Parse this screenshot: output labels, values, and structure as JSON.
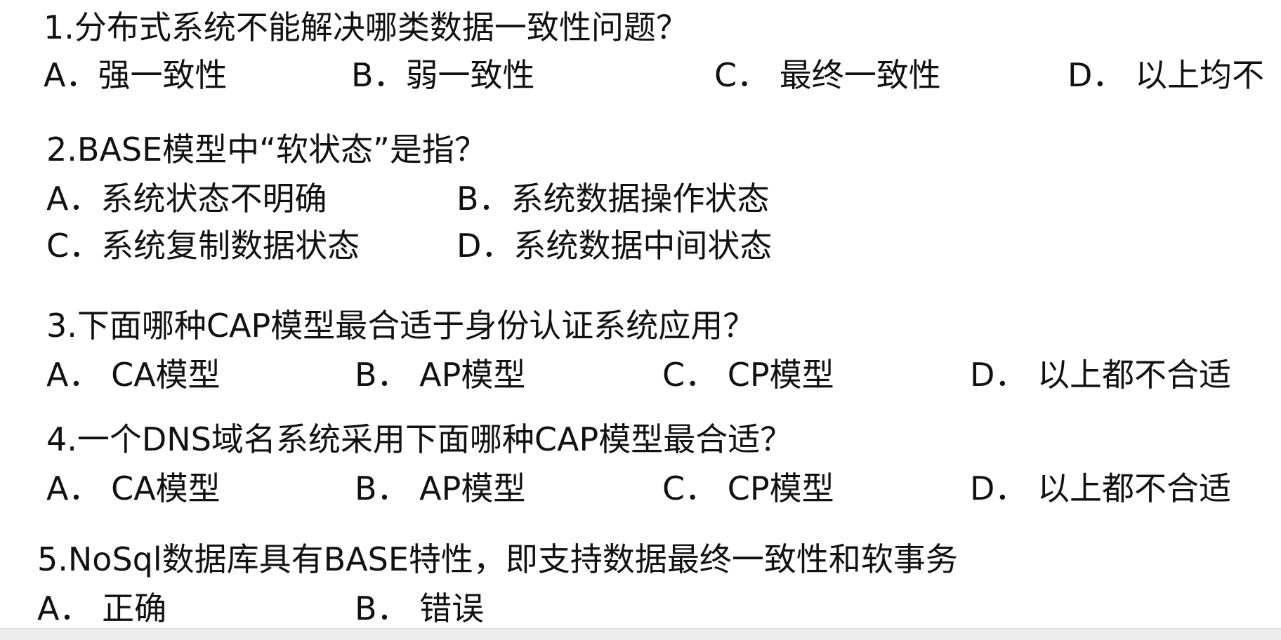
{
  "questions": [
    {
      "stem": "1.分布式系统不能解决哪类数据一致性问题？",
      "options": [
        "A．强一致性",
        "B．弱一致性",
        "C．  最终一致性",
        "D．  以上均不"
      ]
    },
    {
      "stem": "2.BASE模型中“软状态”是指？",
      "options": [
        "A．系统状态不明确",
        "B．系统数据操作状态",
        "C．系统复制数据状态",
        "D．系统数据中间状态"
      ]
    },
    {
      "stem": "3.下面哪种CAP模型最合适于身份认证系统应用？",
      "options": [
        "A．  CA模型",
        "B．  AP模型",
        "C．  CP模型",
        "D．  以上都不合适"
      ]
    },
    {
      "stem": "4.一个DNS域名系统采用下面哪种CAP模型最合适？",
      "options": [
        "A．  CA模型",
        "B．  AP模型",
        "C．  CP模型",
        "D．  以上都不合适"
      ]
    },
    {
      "stem": "5.NoSql数据库具有BASE特性，即支持数据最终一致性和软事务",
      "options": [
        "A．  正确",
        "B．  错误"
      ]
    }
  ]
}
